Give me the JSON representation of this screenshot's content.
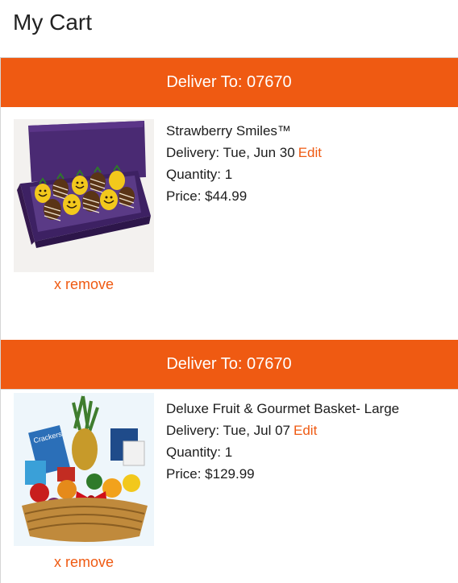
{
  "header": {
    "title": "My Cart"
  },
  "cart": {
    "items": [
      {
        "deliver_to": "Deliver To: 07670",
        "name": "Strawberry Smiles™",
        "delivery": "Delivery: Tue, Jun 30",
        "edit_label": "Edit",
        "quantity": "Quantity: 1",
        "price": "Price: $44.99",
        "remove_label": "x remove",
        "image_desc": "strawberry-box-image"
      },
      {
        "deliver_to": "Deliver To: 07670",
        "name": "Deluxe Fruit & Gourmet Basket- Large",
        "delivery": "Delivery: Tue, Jul 07",
        "edit_label": "Edit",
        "quantity": "Quantity: 1",
        "price": "Price: $129.99",
        "remove_label": "x remove",
        "image_desc": "fruit-basket-image"
      }
    ]
  },
  "colors": {
    "accent": "#ef5a12",
    "band_text": "#ffffff"
  }
}
